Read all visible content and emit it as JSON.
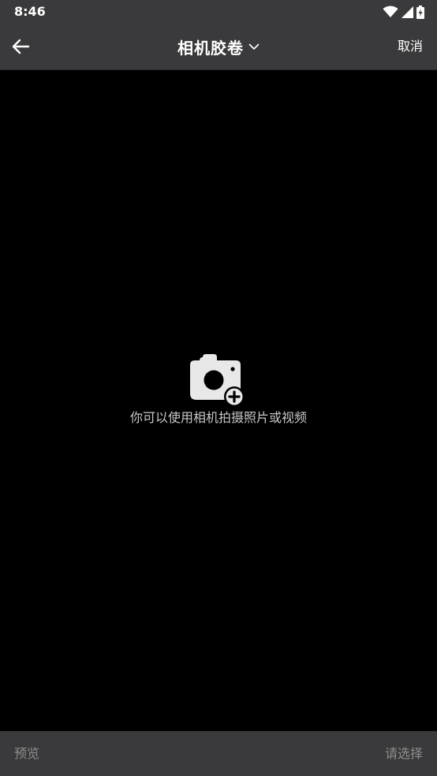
{
  "status_bar": {
    "time": "8:46",
    "icons": [
      "wifi-icon",
      "signal-icon",
      "battery-charging-icon"
    ]
  },
  "header": {
    "back_icon": "arrow-left-icon",
    "title": "相机胶卷",
    "dropdown_icon": "chevron-down-icon",
    "cancel_label": "取消"
  },
  "empty_state": {
    "icon": "camera-add-icon",
    "message": "你可以使用相机拍摄照片或视频"
  },
  "footer": {
    "preview_label": "预览",
    "select_label": "请选择"
  },
  "colors": {
    "bar_background": "#3a3a3c",
    "content_background": "#000000",
    "primary_text": "#ffffff",
    "disabled_text": "#8e8e8e",
    "hint_text": "#c8c8c8"
  }
}
